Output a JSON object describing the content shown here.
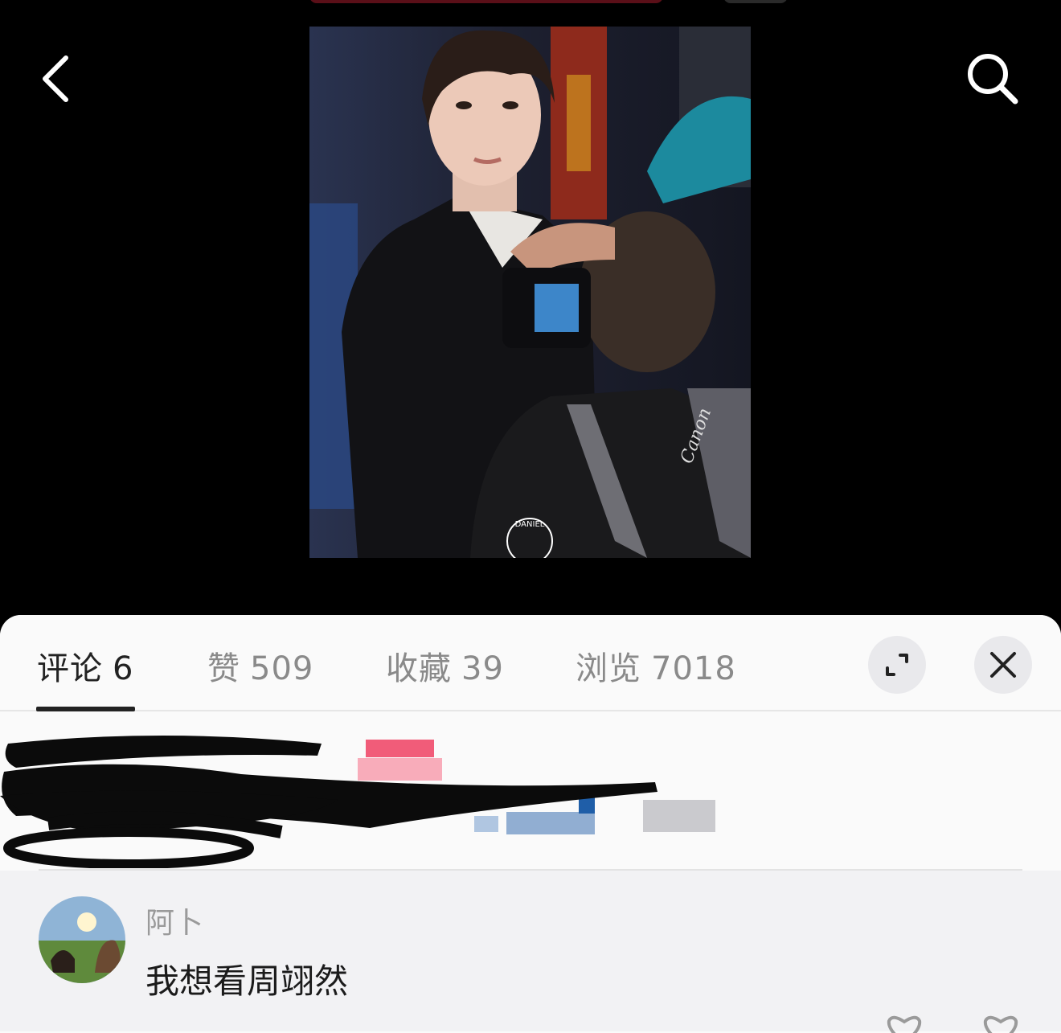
{
  "tabs": [
    {
      "label": "评论",
      "count": "6"
    },
    {
      "label": "赞",
      "count": "509"
    },
    {
      "label": "收藏",
      "count": "39"
    },
    {
      "label": "浏览",
      "count": "7018"
    }
  ],
  "photo": {
    "watermark": "DANIEL",
    "camera_brand": "Canon"
  },
  "comment": {
    "author": "阿卜",
    "text": "我想看周翊然"
  },
  "icons": {
    "back": "chevron-left-icon",
    "search": "search-icon",
    "expand": "expand-icon",
    "close": "close-icon",
    "like": "heart-icon"
  },
  "colors": {
    "active_tab": "#222222",
    "inactive_tab": "#8a8a8a",
    "sheet_bg": "#fafafa"
  }
}
